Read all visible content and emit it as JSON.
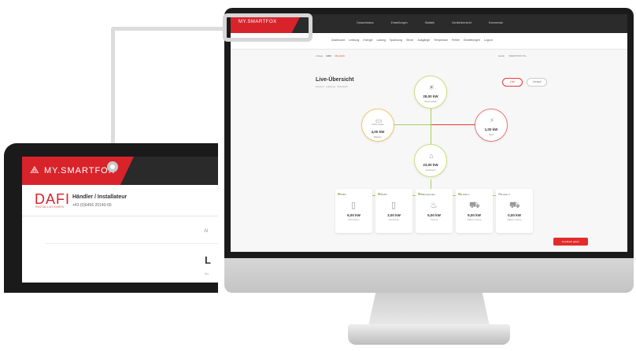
{
  "colors": {
    "brand_red": "#d8232a",
    "dark": "#2b2b2b",
    "accent_green": "#a8cf63"
  },
  "tablet": {
    "logo_text": "MY.SMARTFOX",
    "dealer_logo": "DAFI",
    "dealer_logo_sub": "INSTALLATIONEN",
    "dealer_title": "Händler / Installateur",
    "dealer_phone": "+43 (0)6456 20140-66",
    "partial_text_1": "Al",
    "partial_heading": "L",
    "partial_text_2": "An"
  },
  "desktop": {
    "logo_text": "MY.SMARTFOX",
    "top_nav": [
      "Gesamtstatus",
      "Einstellungen",
      "Statistik",
      "Geräteübersicht",
      "Kommentar"
    ],
    "sub_nav": [
      "Dashboard",
      "Leistung",
      "Energie",
      "Ladung",
      "Spannung",
      "Strom",
      "Ausgänge",
      "Temperatur",
      "Fehler",
      "Einstellungen",
      "Logout"
    ],
    "breadcrumb": [
      "Anlage",
      "DAFI",
      "Übersicht"
    ],
    "device_select": [
      "Gerät",
      "SMARTFOX Pro"
    ],
    "page_title": "Live-Übersicht",
    "page_subtitle": "Gesamt · Leistung · Verbrauch",
    "btn_live": "Live",
    "btn_history": "Verlauf",
    "nodes": {
      "solar": {
        "value": "28,00",
        "unit": "kW",
        "label": "Photovoltaik"
      },
      "battery": {
        "value": "4,00",
        "unit": "kW",
        "label": "Batterie",
        "badge": "100% Laden"
      },
      "grid": {
        "value": "1,00",
        "unit": "kW",
        "label": "Netz"
      },
      "house": {
        "value": "23,00",
        "unit": "kW",
        "label": "Verbrauch"
      }
    },
    "cards": [
      {
        "name": "Puffer",
        "value": "6,00 kW",
        "desc": "Warmwasser",
        "icon": "boiler-icon"
      },
      {
        "name": "WLAN",
        "value": "3,00 kW",
        "desc": "Verbraucher",
        "icon": "socket-icon"
      },
      {
        "name": "Wärmepumpe",
        "value": "5,00 kW",
        "desc": "Heizung",
        "icon": "heatpump-icon"
      },
      {
        "name": "E-Auto 1",
        "value": "9,00 kW",
        "desc": "Wallbox Ladung",
        "icon": "car-icon"
      },
      {
        "name": "E-Auto 2",
        "value": "0,00 kW",
        "desc": "Wallbox Ladung",
        "icon": "car-icon"
      }
    ],
    "feedback_button": "Feedback geben"
  }
}
